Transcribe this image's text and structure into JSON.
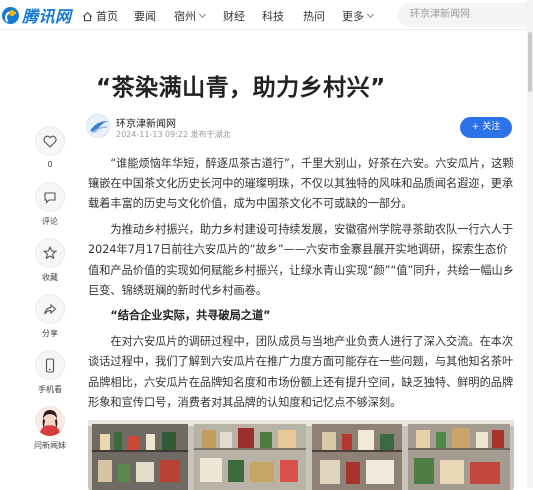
{
  "header": {
    "logo_text": "腾讯网",
    "nav": [
      {
        "label": "首页",
        "icon": "home-icon"
      },
      {
        "label": "要闻"
      },
      {
        "label": "宿州",
        "dropdown": true
      },
      {
        "label": "财经"
      },
      {
        "label": "科技"
      },
      {
        "label": "热问"
      },
      {
        "label": "更多",
        "dropdown": true
      }
    ],
    "search_placeholder": "环京津新闻网"
  },
  "article": {
    "title": "“茶染满山青，助力乡村兴”",
    "author": {
      "name": "环京津新闻网",
      "meta": "2024-11-13 09:22 发布于湖北"
    },
    "follow_label": "+ 关注",
    "paragraphs": [
      "“谁能烦恼年华短，醉逐瓜茶古道行”，千里大别山，好茶在六安。六安瓜片，这颗镶嵌在中国茶文化历史长河中的璀璨明珠，不仅以其独特的风味和品质闻名遐迩，更承载着丰富的历史与文化价值，成为中国茶文化不可或缺的一部分。",
      "为推动乡村振兴，助力乡村建设可持续发展，安徽宿州学院寻茶助农队一行六人于2024年7月17日前往六安瓜片的“故乡”——六安市金寨县展开实地调研，探索生态价值和产品价值的实现如何赋能乡村振兴，让绿水青山实现“颜”“值”同升，共绘一幅山乡巨变、锦绣斑斓的新时代乡村画卷。",
      "“结合企业实际，共寻破局之道”",
      "在对六安瓜片的调研过程中，团队成员与当地产业负责人进行了深入交流。在本次谈话过程中，我们了解到六安瓜片在推广力度方面可能存在一些问题，与其他知名茶叶品牌相比，六安瓜片在品牌知名度和市场份额上还有提升空间，缺乏独特、鲜明的品牌形象和宣传口号，消费者对其品牌的认知度和记忆点不够深刻。"
    ]
  },
  "rail": {
    "like": {
      "label": "0",
      "icon": "heart-icon"
    },
    "comment": {
      "label": "评论",
      "icon": "comment-icon"
    },
    "favorite": {
      "label": "收藏",
      "icon": "star-icon"
    },
    "share": {
      "label": "分享",
      "icon": "share-icon"
    },
    "mobile": {
      "label": "手机看",
      "icon": "phone-icon"
    },
    "ask": {
      "label": "问新闻妹",
      "icon": "assistant-avatar-icon"
    }
  },
  "colors": {
    "brand_blue": "#1479d7",
    "follow_button": "#2d72e6",
    "logo_accent": "#f7b500"
  }
}
